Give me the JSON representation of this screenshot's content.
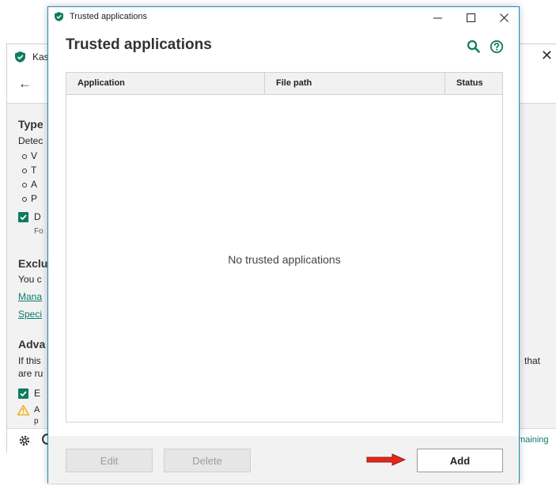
{
  "background_window": {
    "title": "Kas",
    "sections": {
      "type": {
        "heading": "Type",
        "description": "Detec",
        "bullets": [
          "V",
          "T",
          "A",
          "P"
        ],
        "checkbox_label": "D",
        "checkbox_sub": "Fo"
      },
      "exclusions": {
        "heading": "Exclu",
        "description": "You c",
        "link1": "Mana",
        "link2": "Speci"
      },
      "advanced": {
        "heading": "Adva",
        "line1": "If this",
        "line1_right": "that",
        "line2": "are ru",
        "checkbox_label": "E",
        "warning_label": "A",
        "warning_sub": "p"
      }
    },
    "status_right": "maining"
  },
  "dialog": {
    "window_title": "Trusted applications",
    "heading": "Trusted applications",
    "columns": [
      "Application",
      "File path",
      "Status"
    ],
    "empty_message": "No trusted applications",
    "buttons": {
      "edit": "Edit",
      "delete": "Delete",
      "add": "Add"
    }
  },
  "icons": {
    "brand": "kaspersky-shield-icon",
    "search": "search-icon",
    "help": "help-icon",
    "minimize": "minimize-icon",
    "maximize": "maximize-icon",
    "close": "close-icon",
    "back": "back-arrow-icon",
    "settings": "gear-icon",
    "warning": "warning-icon",
    "arrow": "red-pointer-arrow-icon"
  },
  "colors": {
    "brand_green": "#0f7b5e",
    "dialog_border": "#1e88c7",
    "link": "#0a7b6b",
    "warning": "#f0a800",
    "arrow_red": "#e0281c"
  }
}
